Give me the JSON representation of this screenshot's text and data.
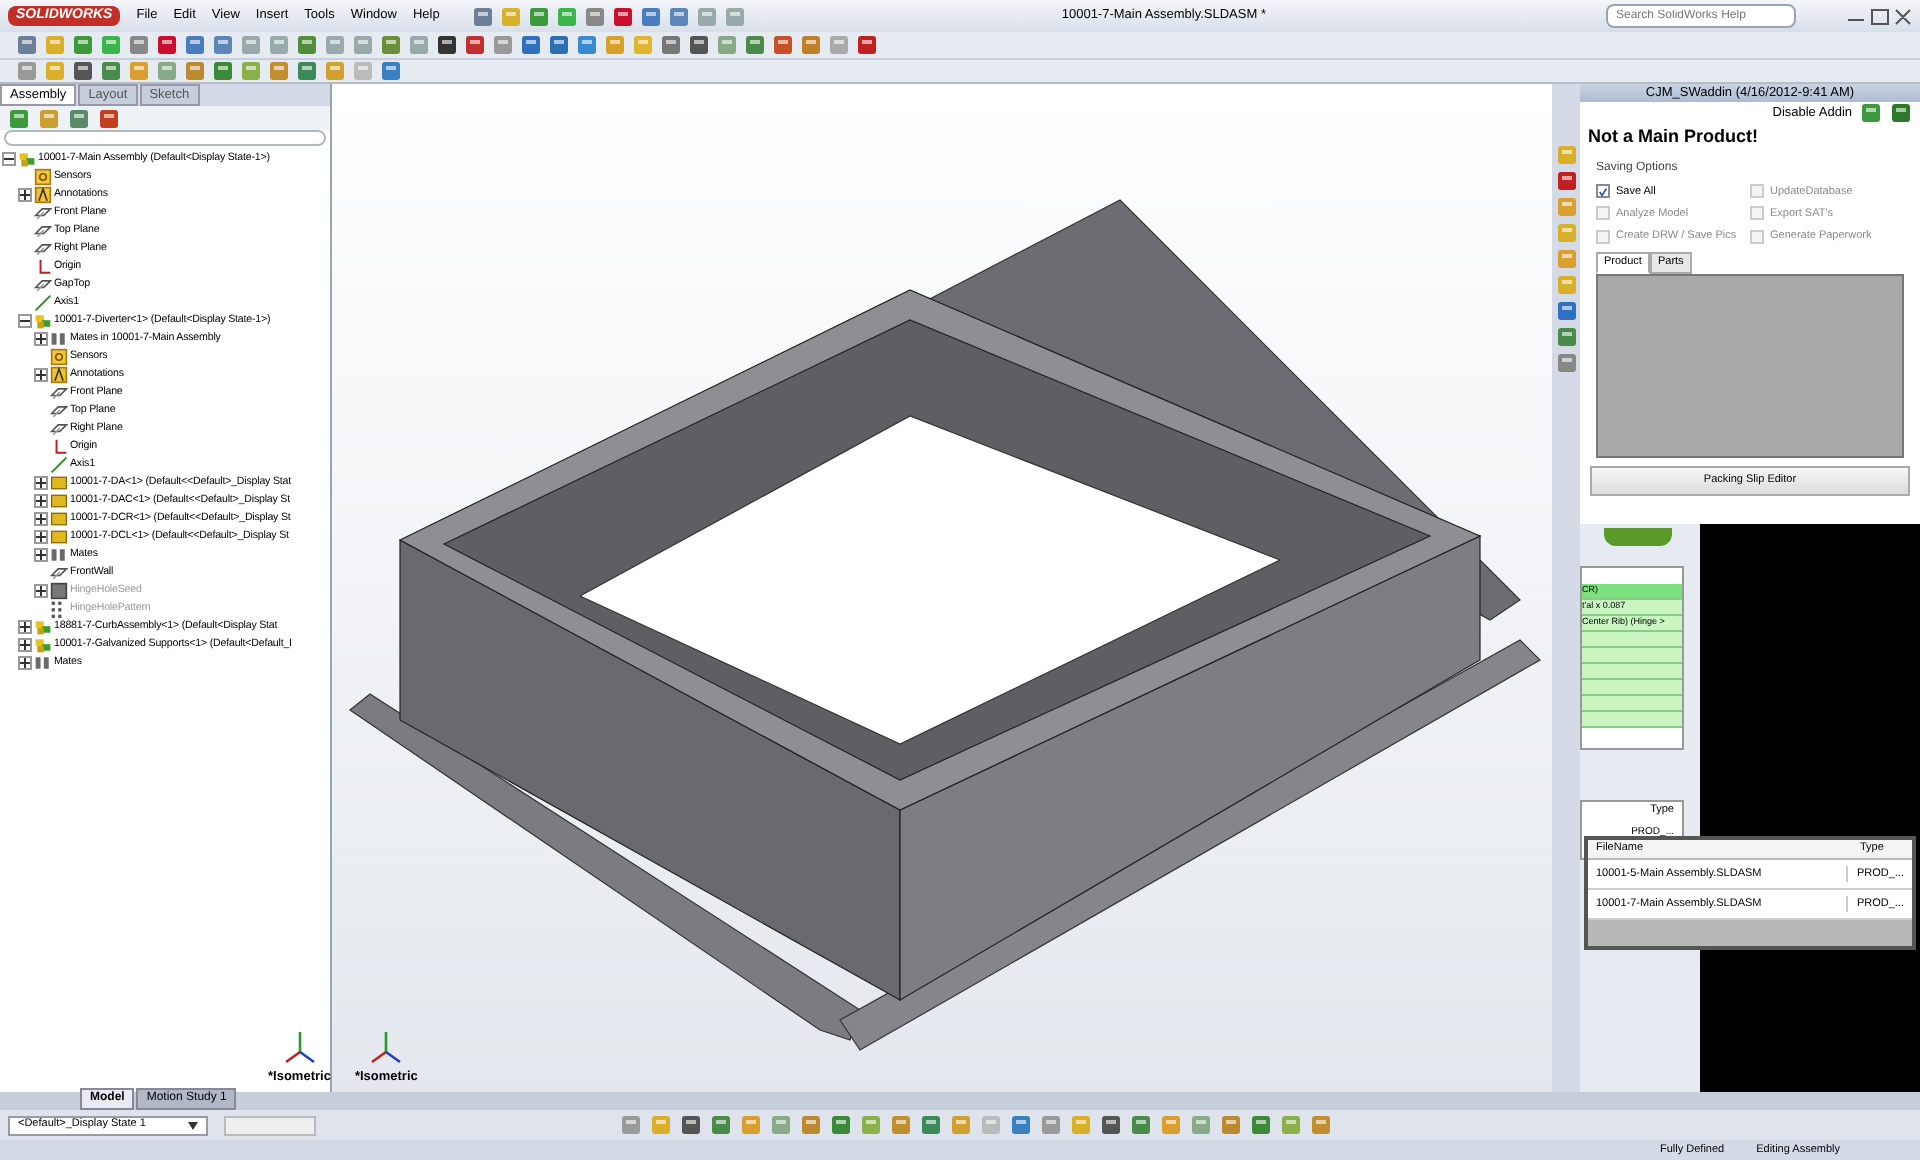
{
  "app": {
    "logo": "SOLIDWORKS",
    "menus": [
      "File",
      "Edit",
      "View",
      "Insert",
      "Tools",
      "Window",
      "Help"
    ],
    "title": "10001-7-Main Assembly.SLDASM *",
    "search": {
      "placeholder": "Search SolidWorks Help"
    }
  },
  "left_tabs": [
    {
      "label": "Assembly",
      "selected": true
    },
    {
      "label": "Layout",
      "selected": false
    },
    {
      "label": "Sketch",
      "selected": false
    }
  ],
  "tree": [
    {
      "label": "10001-7-Main Assembly  (Default<Display State-1>)",
      "kind": "assembly",
      "expanded": true,
      "disabled": false,
      "children": [
        {
          "label": "Sensors",
          "kind": "sensor",
          "disabled": false
        },
        {
          "label": "Annotations",
          "kind": "annotation",
          "expanded": false,
          "disabled": false
        },
        {
          "label": "Front Plane",
          "kind": "plane",
          "disabled": false
        },
        {
          "label": "Top Plane",
          "kind": "plane",
          "disabled": false
        },
        {
          "label": "Right Plane",
          "kind": "plane",
          "disabled": false
        },
        {
          "label": "Origin",
          "kind": "origin",
          "disabled": false
        },
        {
          "label": "GapTop",
          "kind": "plane",
          "disabled": false
        },
        {
          "label": "Axis1",
          "kind": "axis",
          "disabled": false
        },
        {
          "label": "10001-7-Diverter<1> (Default<Display State-1>)",
          "kind": "assembly",
          "expanded": true,
          "disabled": false,
          "children": [
            {
              "label": "Mates in 10001-7-Main Assembly",
              "kind": "mates",
              "expanded": false,
              "disabled": false
            },
            {
              "label": "Sensors",
              "kind": "sensor",
              "disabled": false
            },
            {
              "label": "Annotations",
              "kind": "annotation",
              "expanded": false,
              "disabled": false
            },
            {
              "label": "Front Plane",
              "kind": "plane",
              "disabled": false
            },
            {
              "label": "Top Plane",
              "kind": "plane",
              "disabled": false
            },
            {
              "label": "Right Plane",
              "kind": "plane",
              "disabled": false
            },
            {
              "label": "Origin",
              "kind": "origin",
              "disabled": false
            },
            {
              "label": "Axis1",
              "kind": "axis",
              "disabled": false
            },
            {
              "label": "10001-7-DA<1> (Default<<Default>_Display Stat",
              "kind": "part",
              "expanded": false,
              "disabled": false
            },
            {
              "label": "10001-7-DAC<1> (Default<<Default>_Display St",
              "kind": "part",
              "expanded": false,
              "disabled": false
            },
            {
              "label": "10001-7-DCR<1> (Default<<Default>_Display St",
              "kind": "part",
              "expanded": false,
              "disabled": false
            },
            {
              "label": "10001-7-DCL<1> (Default<<Default>_Display St",
              "kind": "part",
              "expanded": false,
              "disabled": false
            },
            {
              "label": "Mates",
              "kind": "mates",
              "expanded": false,
              "disabled": false
            },
            {
              "label": "FrontWall",
              "kind": "plane",
              "disabled": false
            },
            {
              "label": "HingeHoleSeed",
              "kind": "feature",
              "expanded": false,
              "disabled": true
            },
            {
              "label": "HingeHolePattern",
              "kind": "pattern",
              "disabled": true
            }
          ]
        },
        {
          "label": "18881-7-CurbAssembly<1> (Default<Display Stat",
          "kind": "assembly",
          "expanded": false,
          "disabled": false
        },
        {
          "label": "10001-7-Galvanized Supports<1> (Default<Default_I",
          "kind": "assembly",
          "expanded": false,
          "disabled": false
        },
        {
          "label": "Mates",
          "kind": "mates",
          "expanded": false,
          "disabled": false
        }
      ]
    }
  ],
  "viewports": [
    {
      "label": "*Isometric"
    },
    {
      "label": "*Isometric"
    }
  ],
  "addin": {
    "title": "CJM_SWaddin (4/16/2012-9:41 AM)",
    "disable_button": "Disable Addin",
    "heading": "Not a Main Product!",
    "section": "Saving Options",
    "options": [
      {
        "label": "Save All",
        "checked": true,
        "disabled": false
      },
      {
        "label": "UpdateDatabase",
        "checked": false,
        "disabled": true
      },
      {
        "label": "Analyze Model",
        "checked": false,
        "disabled": true
      },
      {
        "label": "Export SAT's",
        "checked": false,
        "disabled": true
      },
      {
        "label": "Create DRW / Save Pics",
        "checked": false,
        "disabled": true
      },
      {
        "label": "Generate Paperwork",
        "checked": false,
        "disabled": true
      }
    ],
    "tabs": [
      {
        "label": "Product",
        "selected": true
      },
      {
        "label": "Parts",
        "selected": false
      }
    ],
    "editor_button": "Packing Slip Editor"
  },
  "back_list": {
    "rows": [
      {
        "text": "CR)",
        "selected": true
      },
      {
        "text": "t'al x 0.087",
        "selected": false
      },
      {
        "text": "Center Rib) (Hinge >",
        "selected": false
      },
      {
        "text": "",
        "selected": false
      },
      {
        "text": "",
        "selected": false
      },
      {
        "text": "",
        "selected": false
      },
      {
        "text": "",
        "selected": false
      },
      {
        "text": "",
        "selected": false
      },
      {
        "text": "",
        "selected": false
      }
    ]
  },
  "back_table": {
    "column": "Type",
    "cell": "PROD_..."
  },
  "file_table": {
    "columns": [
      "FileName",
      "Type"
    ],
    "rows": [
      [
        "10001-5-Main Assembly.SLDASM",
        "PROD_..."
      ],
      [
        "10001-7-Main Assembly.SLDASM",
        "PROD_..."
      ]
    ]
  },
  "bottom_tabs": [
    {
      "label": "Model",
      "selected": true
    },
    {
      "label": "Motion Study 1",
      "selected": false
    }
  ],
  "display_state": "<Default>_Display State 1",
  "status": [
    "Fully Defined",
    "Editing Assembly"
  ]
}
